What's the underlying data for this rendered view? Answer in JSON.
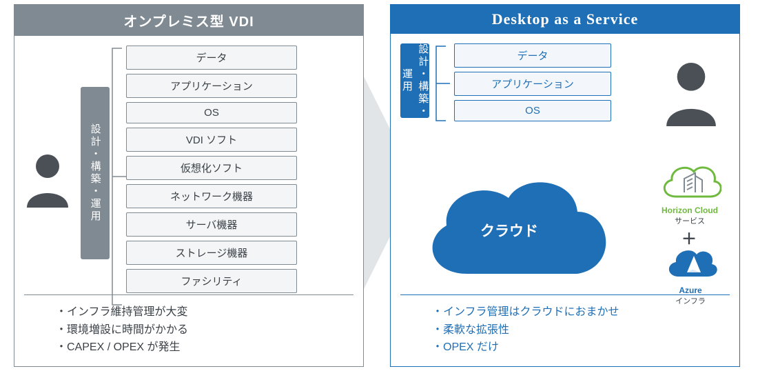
{
  "left": {
    "title": "オンプレミス型 VDI",
    "tag_lines": "設計・構築・運用",
    "layers": [
      "データ",
      "アプリケーション",
      "OS",
      "VDI ソフト",
      "仮想化ソフト",
      "ネットワーク機器",
      "サーバ機器",
      "ストレージ機器",
      "ファシリティ"
    ],
    "bullets": [
      "・インフラ維持管理が大変",
      "・環境増設に時間がかかる",
      "・CAPEX / OPEX が発生"
    ]
  },
  "right": {
    "title": "Desktop as a Service",
    "tag_lines": "設計・構築・運用",
    "layers": [
      "データ",
      "アプリケーション",
      "OS"
    ],
    "cloud": "クラウド",
    "horizon": {
      "name": "Horizon Cloud",
      "sub": "サービス"
    },
    "azure": {
      "name": "Azure",
      "sub": "インフラ"
    },
    "plus": "＋",
    "bullets": [
      "・インフラ管理はクラウドにおまかせ",
      "・柔軟な拡張性",
      "・OPEX だけ"
    ]
  }
}
